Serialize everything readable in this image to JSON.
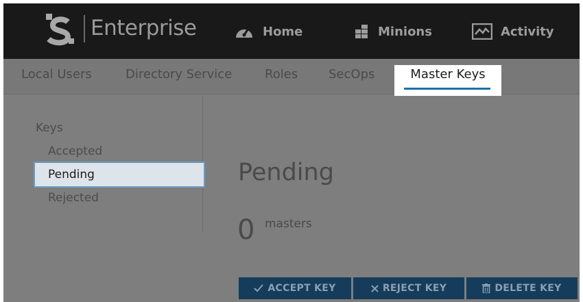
{
  "header": {
    "brand": "Enterprise",
    "nav": [
      {
        "label": "Home",
        "icon": "speedometer-icon"
      },
      {
        "label": "Minions",
        "icon": "minions-icon"
      },
      {
        "label": "Activity",
        "icon": "activity-icon"
      }
    ]
  },
  "tabs": [
    "Local Users",
    "Directory Service",
    "Roles",
    "SecOps",
    "Master Keys"
  ],
  "active_tab": "Master Keys",
  "sidebar": {
    "heading": "Keys",
    "items": [
      "Accepted",
      "Pending",
      "Rejected"
    ],
    "active_item": "Pending"
  },
  "main": {
    "title": "Pending",
    "count": "0",
    "count_label": "masters"
  },
  "actions": {
    "accept_label": "ACCEPT KEY",
    "reject_label": "REJECT KEY",
    "delete_label": "DELETE KEY"
  },
  "colors": {
    "header_bg": "#191919",
    "accent": "#1b6ea3",
    "button_bg": "#163c5b"
  }
}
